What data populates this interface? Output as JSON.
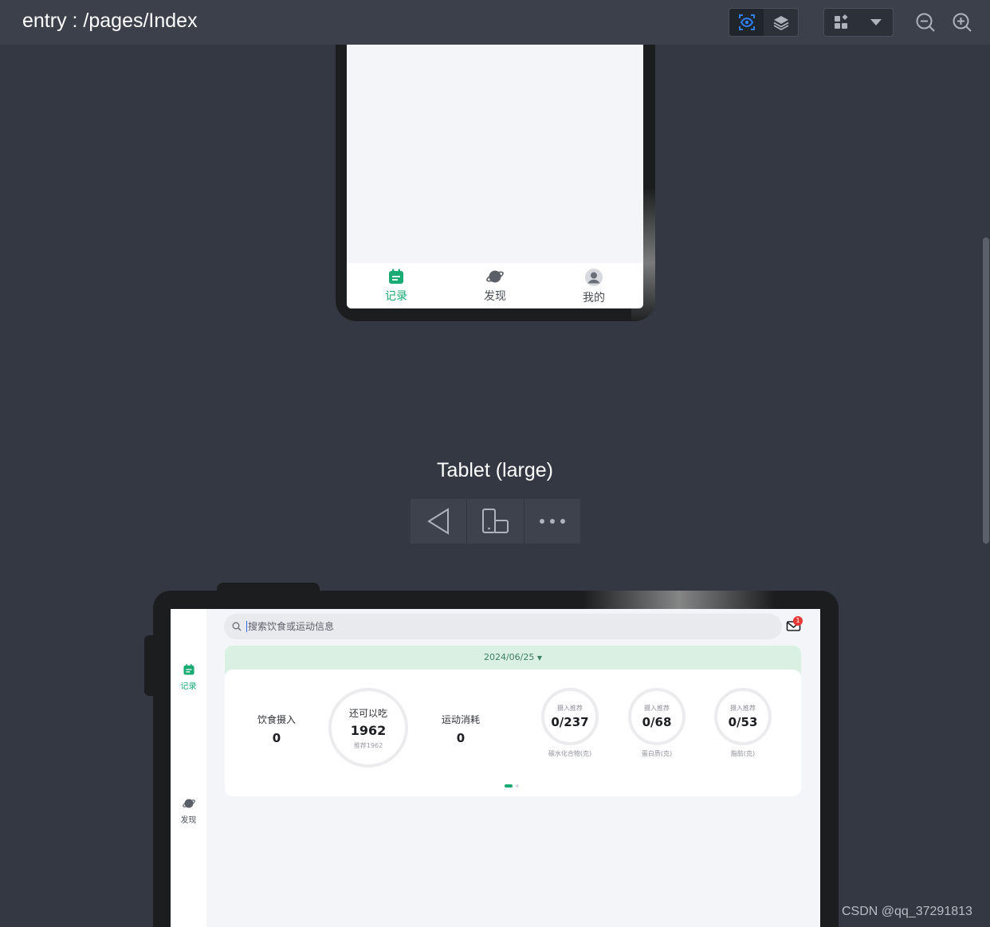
{
  "toolbar": {
    "title": "entry : /pages/Index",
    "icons": [
      "eye-scan-icon",
      "layers-icon",
      "widgets-icon",
      "dropdown-icon",
      "zoom-out-icon",
      "zoom-in-icon"
    ]
  },
  "phone": {
    "tabs": [
      {
        "label": "记录",
        "icon": "record-calendar-icon",
        "active": true
      },
      {
        "label": "发现",
        "icon": "planet-icon",
        "active": false
      },
      {
        "label": "我的",
        "icon": "user-avatar-icon",
        "active": false
      }
    ]
  },
  "device": {
    "name": "Tablet (large)",
    "controls": [
      "back-triangle-icon",
      "rotate-device-icon",
      "more-dots-icon"
    ]
  },
  "tablet": {
    "sidebar": [
      {
        "label": "记录",
        "active": true
      },
      {
        "label": "发现",
        "active": false
      }
    ],
    "search_placeholder": "搜索饮食或运动信息",
    "mail_badge": "1",
    "date": "2024/06/25",
    "summary": {
      "intake_label": "饮食摄入",
      "intake_value": "0",
      "remaining_label": "还可以吃",
      "remaining_value": "1962",
      "recommend_text": "推荐1962",
      "exercise_label": "运动消耗",
      "exercise_value": "0"
    },
    "nutrients": [
      {
        "title": "摄入推荐",
        "value": "0/237",
        "label": "碳水化合物(克)"
      },
      {
        "title": "摄入推荐",
        "value": "0/68",
        "label": "蛋白质(克)"
      },
      {
        "title": "摄入推荐",
        "value": "0/53",
        "label": "脂肪(克)"
      }
    ],
    "page_indicator": {
      "count": 2,
      "active": 0
    }
  },
  "colors": {
    "accent": "#1aaa73",
    "canvas": "#333843",
    "toolbar": "#3b404b",
    "date_bar": "#d9f0e2",
    "badge": "#e53935"
  },
  "watermark": "CSDN @qq_37291813"
}
